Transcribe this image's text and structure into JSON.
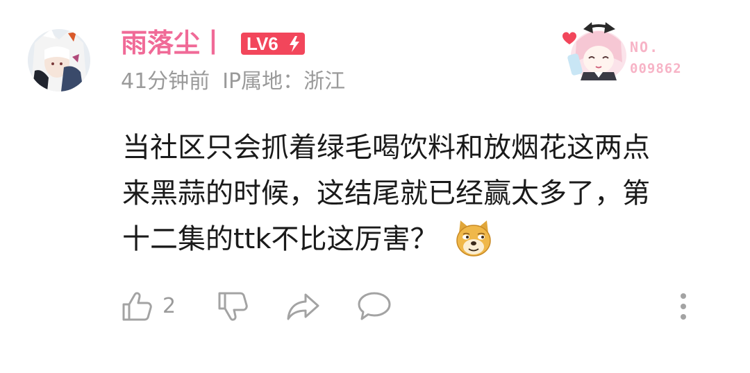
{
  "comment": {
    "username": "雨落尘丨",
    "level_label": "LV6",
    "time_ago": "41分钟前",
    "ip_location": "IP属地：浙江",
    "text_lines": [
      "当社区只会抓着绿毛喝饮料和放烟花这两点",
      "来黑蒜的时候，这结尾就已经赢太多了，第",
      "十二集的ttk不比这厉害？"
    ],
    "emoji_icon": "doge-emoji-icon",
    "fan_badge": {
      "label": "NO.",
      "number": "009862"
    },
    "actions": {
      "like_count": "2",
      "like_icon": "thumbs-up-icon",
      "dislike_icon": "thumbs-down-icon",
      "share_icon": "share-icon",
      "reply_icon": "comment-icon",
      "more_icon": "more-vertical-icon"
    }
  },
  "colors": {
    "username": "#f06a97",
    "level_badge": "#f2465b",
    "meta_text": "#9a9a9a",
    "icon_gray": "#a3a3a3",
    "body_text": "#1a1a1a"
  }
}
